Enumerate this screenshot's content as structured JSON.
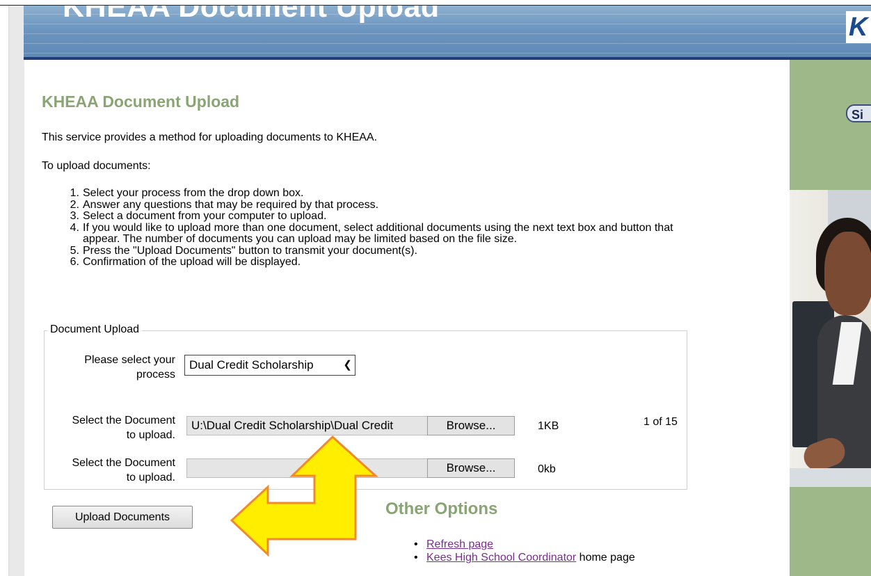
{
  "header": {
    "title": "KHEAA Document Upload",
    "logo_text": "K"
  },
  "side": {
    "signin_label": "Si"
  },
  "main": {
    "title": "KHEAA Document Upload",
    "intro": "This service provides a method for uploading documents to KHEAA.",
    "intro2": "To upload documents:",
    "steps": [
      {
        "num": "1.",
        "text": "Select your process from the drop down box."
      },
      {
        "num": "2.",
        "text": "Answer any questions that may be required by that process."
      },
      {
        "num": "3.",
        "text": "Select a document from your computer to upload."
      },
      {
        "num": "4.",
        "text": "If you would like to upload more than one document, select additional documents using the next text box and button that appear. The number of documents you can upload may be limited based on the file size."
      },
      {
        "num": "5.",
        "text": "Press the \"Upload Documents\" button to transmit your document(s)."
      },
      {
        "num": "6.",
        "text": "Confirmation of the upload will be displayed."
      }
    ]
  },
  "form": {
    "legend": "Document Upload",
    "process_label_line1": "Please select your",
    "process_label_line2": "process",
    "process_value": "Dual Credit Scholarship",
    "doc_label_line1": "Select the Document",
    "doc_label_line2": "to upload.",
    "file1_value": "U:\\Dual Credit Scholarship\\Dual Credit",
    "file2_value": "",
    "browse_label": "Browse...",
    "file1_size": "1KB",
    "file2_size": "0kb",
    "count": "1 of 15",
    "upload_button": "Upload Documents"
  },
  "other": {
    "title": "Other Options",
    "link1": "Refresh page",
    "link2": "Kees High School Coordinator",
    "link2_suffix": " home page",
    "bullet": "•"
  },
  "colors": {
    "accent_green": "#8aa574",
    "header_blue": "#6b95bf",
    "arrow_fill": "#ffee00",
    "arrow_stroke": "#f08a2a"
  }
}
